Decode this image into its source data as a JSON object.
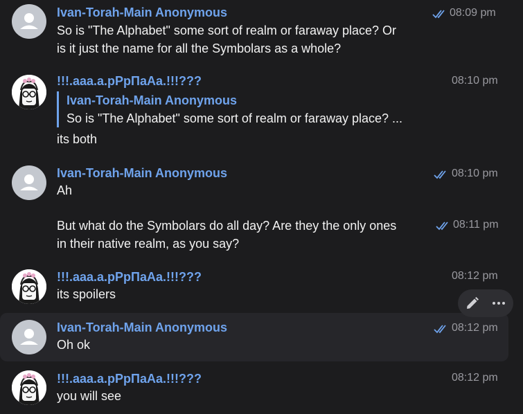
{
  "messages": [
    {
      "sender": "Ivan-Torah-Main Anonymous",
      "lines": [
        "So is \"The Alphabet\" some sort of realm or faraway place? Or",
        "is it just the name for all the Symbolars as a whole?"
      ],
      "time": "08:09 pm",
      "read": true
    },
    {
      "sender": "!!!.aaa.a.pPpПaAa.!!!???",
      "reply": {
        "name": "Ivan-Torah-Main Anonymous",
        "text": "So is \"The Alphabet\" some sort of realm or faraway place? ..."
      },
      "lines": [
        "its both"
      ],
      "time": "08:10 pm",
      "read": false
    },
    {
      "sender": "Ivan-Torah-Main Anonymous",
      "lines": [
        "Ah"
      ],
      "time": "08:10 pm",
      "read": true
    },
    {
      "lines": [
        "But what do the Symbolars do all day? Are they the only ones",
        "in their native realm, as you say?"
      ],
      "time": "08:11 pm",
      "read": true
    },
    {
      "sender": "!!!.aaa.a.pPpПaAa.!!!???",
      "lines": [
        "its spoilers"
      ],
      "time": "08:12 pm",
      "read": false
    },
    {
      "sender": "Ivan-Torah-Main Anonymous",
      "lines": [
        "Oh ok"
      ],
      "time": "08:12 pm",
      "read": true
    },
    {
      "sender": "!!!.aaa.a.pPpПaAa.!!!???",
      "lines": [
        "you will see"
      ],
      "time": "08:12 pm",
      "read": false
    }
  ],
  "icons": {
    "read_receipt": "double-check-icon",
    "edit": "pencil-icon",
    "more": "more-horizontal-icon",
    "default_avatar": "user-silhouette-icon",
    "custom_avatar": "drawn-character-avatar"
  },
  "colors": {
    "background": "#1c1c1e",
    "sender_name": "#6fa3ec",
    "timestamp": "#9a9aa0",
    "check": "#6fa3ec",
    "hover_row": "#26262a"
  }
}
